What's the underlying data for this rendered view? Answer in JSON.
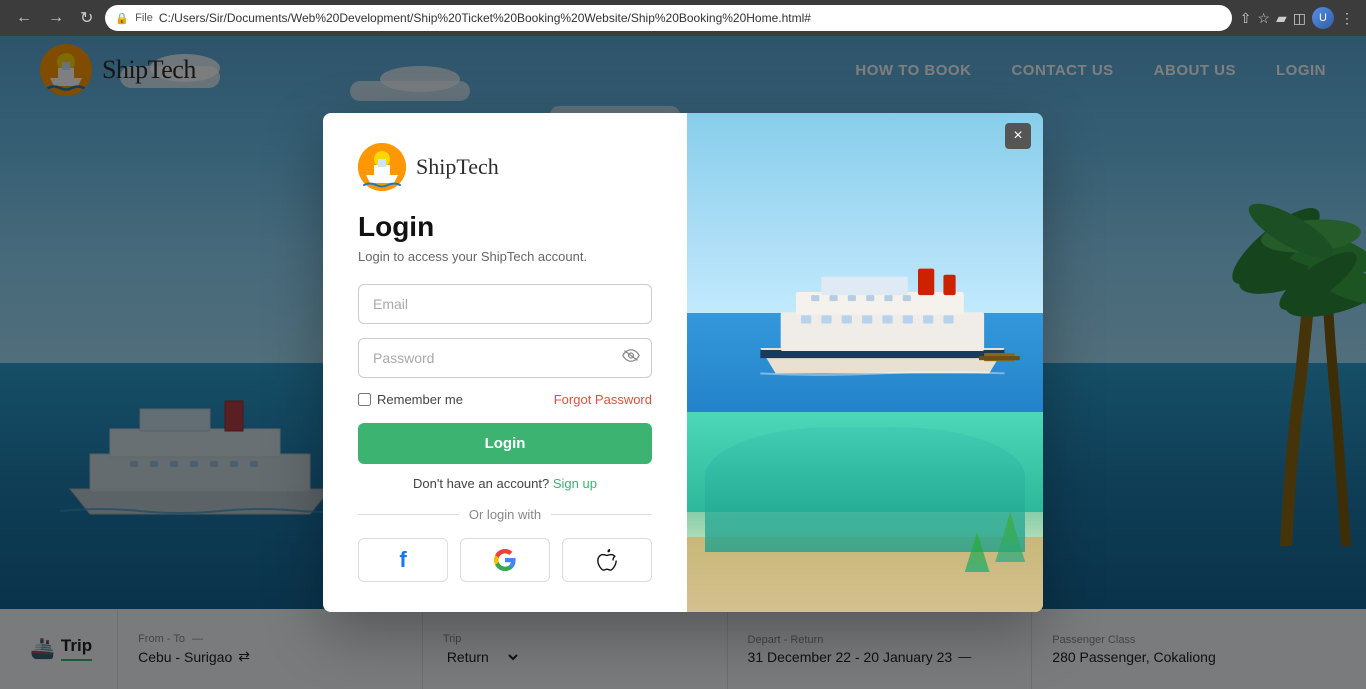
{
  "browser": {
    "url": "C:/Users/Sir/Documents/Web%20Development/Ship%20Ticket%20Booking%20Website/Ship%20Booking%20Home.html#",
    "file_label": "File"
  },
  "navbar": {
    "logo_text": "ShipTech",
    "links": {
      "how_to_book": "HOW TO BOOK",
      "contact_us": "CONTACT US",
      "about_us": "ABOUT US",
      "login": "LOGIN"
    }
  },
  "modal": {
    "logo_text": "ShipTech",
    "title": "Login",
    "subtitle": "Login to access your ShipTech account.",
    "email_placeholder": "Email",
    "password_placeholder": "Password",
    "remember_me": "Remember me",
    "forgot_password": "Forgot Password",
    "login_button": "Login",
    "no_account_text": "Don't have an account?",
    "sign_up": "Sign up",
    "or_login_with": "Or login with",
    "close_btn": "×"
  },
  "trip_bar": {
    "trip_icon": "🚢",
    "trip_label": "Trip",
    "from_to_label": "From - To",
    "from_to_value": "Cebu - Surigao",
    "trip_type_label": "Trip",
    "trip_type_value": "Return",
    "depart_return_label": "Depart - Return",
    "depart_return_value": "31 December 22 - 20 January 23",
    "passenger_class_label": "Passenger Class",
    "passenger_class_value": "280 Passenger, Cokaliong"
  }
}
